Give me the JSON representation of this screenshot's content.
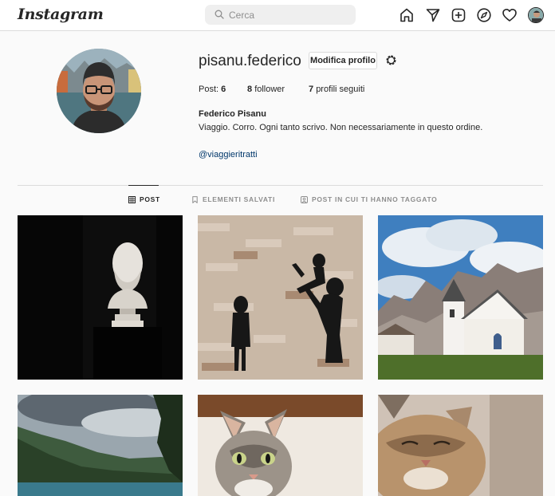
{
  "nav": {
    "logo": "Instagram",
    "search_placeholder": "Cerca",
    "icons": [
      "home-icon",
      "direct-icon",
      "new-post-icon",
      "explore-icon",
      "activity-icon",
      "profile-avatar"
    ]
  },
  "profile": {
    "username": "pisanu.federico",
    "edit_button": "Modifica profilo",
    "stats": {
      "posts_label": "Post:",
      "posts_count": "6",
      "followers_count": "8",
      "followers_label": "follower",
      "following_count": "7",
      "following_label": "profili seguiti"
    },
    "full_name": "Federico Pisanu",
    "bio": "Viaggio. Corro. Ogni tanto scrivo. Non necessariamente in questo ordine.",
    "bio_link": "@viaggieritratti"
  },
  "tabs": [
    {
      "label": "POST",
      "active": true,
      "icon": "grid-icon"
    },
    {
      "label": "ELEMENTI SALVATI",
      "active": false,
      "icon": "bookmark-icon"
    },
    {
      "label": "POST IN CUI TI HANNO TAGGATO",
      "active": false,
      "icon": "tagged-icon"
    }
  ],
  "posts": [
    {
      "subject": "bust-sculpture"
    },
    {
      "subject": "silhouette-wall"
    },
    {
      "subject": "alpine-church"
    },
    {
      "subject": "mountain-lake"
    },
    {
      "subject": "cat-portrait"
    },
    {
      "subject": "cat-sleeping"
    }
  ],
  "colors": {
    "text": "#262626",
    "secondary": "#8e8e8e",
    "link": "#00376b",
    "border": "#dbdbdb",
    "background": "#fafafa"
  }
}
